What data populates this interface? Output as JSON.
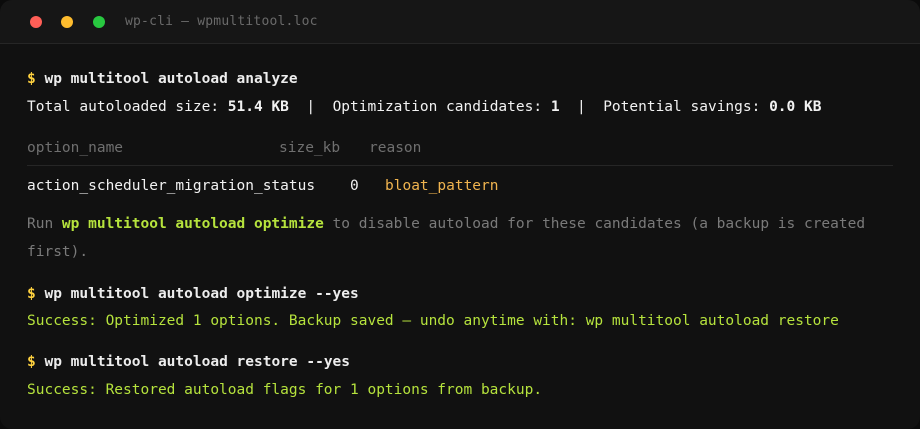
{
  "window": {
    "title": "wp-cli — wpmultitool.loc",
    "colors": {
      "background": "#111111",
      "prompt": "#ffd23f",
      "success": "#b6e33d",
      "reason": "#f0b44f",
      "muted": "#7a7a7a"
    }
  },
  "session": {
    "prompt_symbol": "$",
    "cmd1": "wp multitool autoload analyze",
    "summary": {
      "size_label": "Total autoloaded size: ",
      "size_value": "51.4 KB",
      "sep1": "  |  ",
      "candidates_label": "Optimization candidates: ",
      "candidates_value": "1",
      "sep2": "  |  ",
      "savings_label": "Potential savings: ",
      "savings_value": "0.0 KB"
    },
    "table": {
      "headers": [
        "option_name",
        "size_kb",
        "reason"
      ],
      "rows": [
        {
          "option_name": "action_scheduler_migration_status",
          "size_kb": "0",
          "reason": "bloat_pattern"
        }
      ]
    },
    "hint": {
      "prefix": "Run ",
      "command": "wp multitool autoload optimize",
      "suffix_line1": " to disable autoload for these candidates (a backup is created",
      "line2": "first)."
    },
    "cmd2": "wp multitool autoload optimize --yes",
    "result2": "Success: Optimized 1 options. Backup saved — undo anytime with: wp multitool autoload restore",
    "cmd3": "wp multitool autoload restore --yes",
    "result3": "Success: Restored autoload flags for 1 options from backup."
  }
}
